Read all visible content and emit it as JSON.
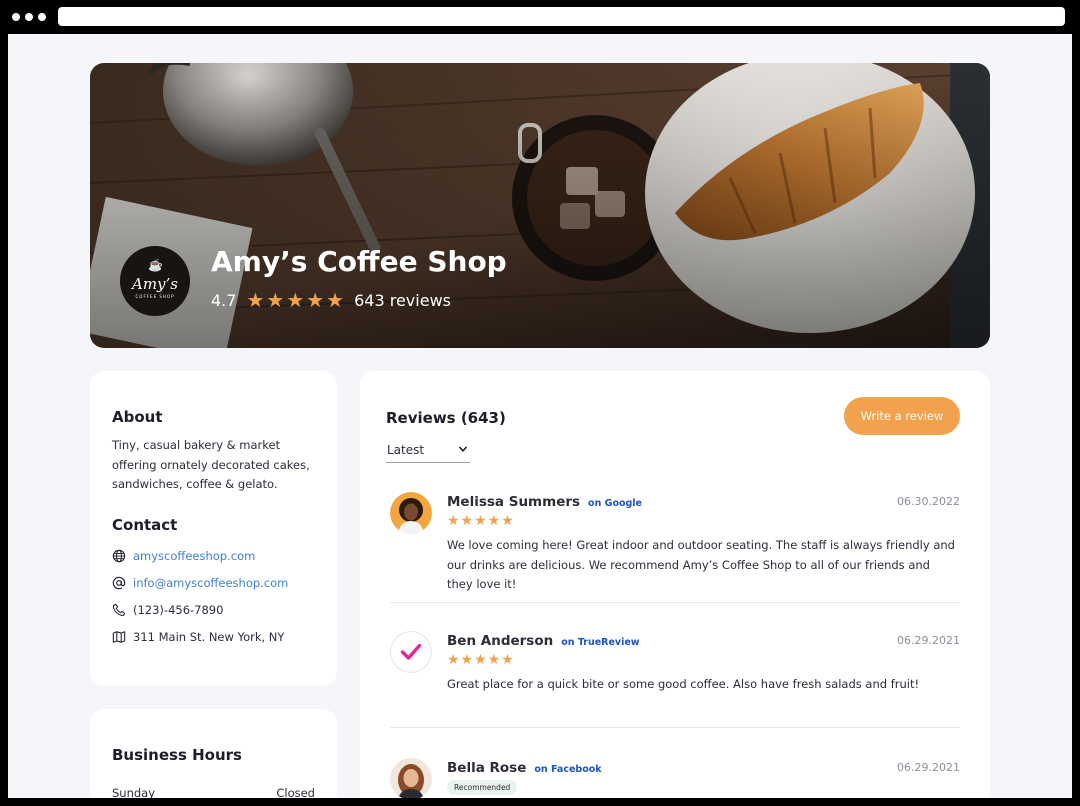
{
  "hero": {
    "logo": {
      "name": "Amy’s",
      "sub": "COFFEE SHOP"
    },
    "title": "Amy’s Coffee Shop",
    "rating": "4.7",
    "stars": "★★★★★",
    "review_count": "643 reviews"
  },
  "about": {
    "heading": "About",
    "text": "Tiny, casual bakery & market offering ornately decorated cakes, sandwiches, coffee & gelato."
  },
  "contact": {
    "heading": "Contact",
    "website": "amyscoffeeshop.com",
    "email": "info@amyscoffeeshop.com",
    "phone": "(123)-456-7890",
    "address": "311 Main St. New York, NY"
  },
  "hours": {
    "heading": "Business Hours",
    "rows": [
      {
        "day": "Sunday",
        "value": "Closed"
      }
    ]
  },
  "reviews": {
    "heading": "Reviews (643)",
    "write_label": "Write a review",
    "sort_value": "Latest",
    "items": [
      {
        "name": "Melissa Summers",
        "source": "on Google",
        "date": "06.30.2022",
        "stars": "★★★★★",
        "text": "We love coming here! Great indoor and outdoor seating. The staff is always friendly and our drinks are delicious. We recommend Amy’s Coffee Shop to all of our friends and they love it!"
      },
      {
        "name": "Ben Anderson",
        "source": "on TrueReview",
        "date": "06.29.2021",
        "stars": "★★★★★",
        "text": "Great place for a quick bite or some good coffee. Also have fresh salads and fruit!"
      },
      {
        "name": "Bella Rose",
        "source": "on Facebook",
        "date": "06.29.2021",
        "badge": "Recommended"
      }
    ]
  },
  "colors": {
    "accent": "#f2a14c",
    "link": "#3f7fd3",
    "source": "#1a55c6",
    "check": "#e8259a"
  },
  "icons": [
    "globe-icon",
    "at-icon",
    "phone-icon",
    "map-icon",
    "chevron-down-icon",
    "check-icon"
  ]
}
